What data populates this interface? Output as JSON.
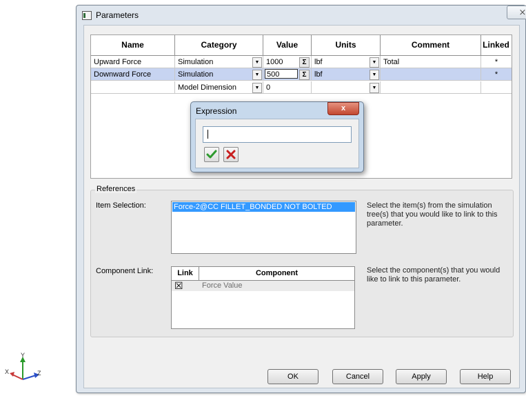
{
  "window": {
    "title": "Parameters",
    "close_glyph": "⨯"
  },
  "table": {
    "columns": [
      "Name",
      "Category",
      "Value",
      "Units",
      "Comment",
      "Linked"
    ],
    "rows": [
      {
        "name": "Upward Force",
        "category": "Simulation",
        "value": "1000",
        "units": "lbf",
        "comment": "Total",
        "linked": "*"
      },
      {
        "name": "Downward Force",
        "category": "Simulation",
        "value": "500",
        "units": "lbf",
        "comment": "",
        "linked": "*"
      },
      {
        "name": "",
        "category": "Model Dimension",
        "value": "0",
        "units": "",
        "comment": "",
        "linked": ""
      }
    ],
    "sigma_glyph": "Σ",
    "dropdown_glyph": "▼"
  },
  "references": {
    "group_label": "References",
    "item_selection_label": "Item Selection:",
    "item_selection_items": [
      "Force-2@CC FILLET_BONDED NOT BOLTED"
    ],
    "item_selection_note": "Select the item(s) from the simulation tree(s) that you would like to link to this parameter.",
    "component_link_label": "Component Link:",
    "component_columns": [
      "Link",
      "Component"
    ],
    "component_rows": [
      {
        "checked": "☒",
        "component": "Force Value"
      }
    ],
    "component_note": "Select the component(s) that you would like to link to this parameter."
  },
  "buttons": {
    "ok": "OK",
    "cancel": "Cancel",
    "apply": "Apply",
    "help": "Help"
  },
  "expression_dialog": {
    "title": "Expression",
    "value": "",
    "close_glyph": "x"
  },
  "triad": {
    "x": "X",
    "y": "Y",
    "z": "Z"
  },
  "colors": {
    "selection_row": "#c7d4f1",
    "list_selection": "#3399ff",
    "accept": "#2e9a2e",
    "reject": "#c81e1e"
  }
}
